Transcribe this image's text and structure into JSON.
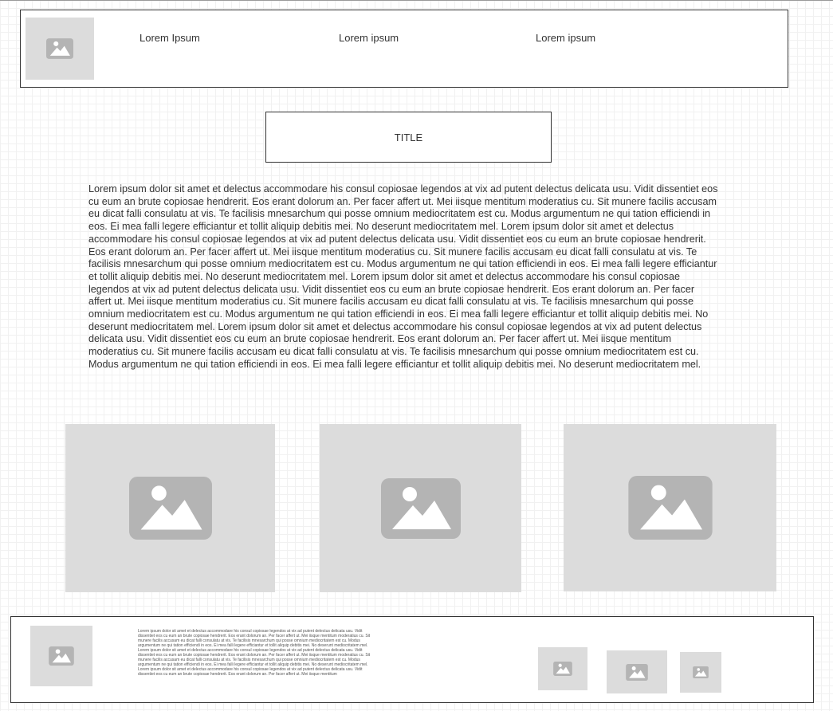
{
  "header": {
    "nav_items": [
      "Lorem Ipsum",
      "Lorem ipsum",
      "Lorem ipsum"
    ]
  },
  "title": "TITLE",
  "body_text": "Lorem ipsum dolor sit amet et delectus accommodare his consul copiosae legendos at vix ad putent delectus delicata usu. Vidit dissentiet eos cu eum an brute copiosae hendrerit. Eos erant dolorum an. Per facer affert ut. Mei iisque mentitum moderatius cu. Sit munere facilis accusam eu dicat falli consulatu at vis. Te facilisis mnesarchum qui posse omnium mediocritatem est cu. Modus argumentum ne qui tation efficiendi in eos. Ei mea falli legere efficiantur et tollit aliquip debitis mei. No deserunt mediocritatem mel. Lorem ipsum dolor sit amet et delectus accommodare his consul copiosae legendos at vix ad putent delectus delicata usu. Vidit dissentiet eos cu eum an brute copiosae hendrerit. Eos erant dolorum an. Per facer affert ut. Mei iisque mentitum moderatius cu. Sit munere facilis accusam eu dicat falli consulatu at vis. Te facilisis mnesarchum qui posse omnium mediocritatem est cu. Modus argumentum ne qui tation efficiendi in eos. Ei mea falli legere efficiantur et tollit aliquip debitis mei. No deserunt mediocritatem mel. Lorem ipsum dolor sit amet et delectus accommodare his consul copiosae legendos at vix ad putent delectus delicata usu. Vidit dissentiet eos cu eum an brute copiosae hendrerit. Eos erant dolorum an. Per facer affert ut. Mei iisque mentitum moderatius cu. Sit munere facilis accusam eu dicat falli consulatu at vis. Te facilisis mnesarchum qui posse omnium mediocritatem est cu. Modus argumentum ne qui tation efficiendi in eos. Ei mea falli legere efficiantur et tollit aliquip debitis mei. No deserunt mediocritatem mel. Lorem ipsum dolor sit amet et delectus accommodare his consul copiosae legendos at vix ad putent delectus delicata usu. Vidit dissentiet eos cu eum an brute copiosae hendrerit. Eos erant dolorum an. Per facer affert ut. Mei iisque mentitum moderatius cu. Sit munere facilis accusam eu dicat falli consulatu at vis. Te facilisis mnesarchum qui posse omnium mediocritatem est cu. Modus argumentum ne qui tation efficiendi in eos. Ei mea falli legere efficiantur et tollit aliquip debitis mei. No deserunt mediocritatem mel.",
  "footer": {
    "text": "Lorem ipsum dolor sit amet et delectus accommodare his consul copiosae legendos at vix ad putent delectus delicata usu. Vidit dissentiet eos cu eum an brute copiosae hendrerit. Eos erant dolorum an. Per facer affert ut. Mei iisque mentitum moderatius cu. Sit munere facilis accusam eu dicat falli consulatu at vis. Te facilisis mnesarchum qui posse omnium mediocritatem est cu. Modus argumentum ne qui tation efficiendi in eos. Ei mea falli legere efficiantur et tollit aliquip debitis mei. No deserunt mediocritatem mel. Lorem ipsum dolor sit amet et delectus accommodare his consul copiosae legendos at vix ad putent delectus delicata usu. Vidit dissentiet eos cu eum an brute copiosae hendrerit. Eos erant dolorum an. Per facer affert ut. Mei iisque mentitum moderatius cu. Sit munere facilis accusam eu dicat falli consulatu at vis. Te facilisis mnesarchum qui posse omnium mediocritatem est cu. Modus argumentum ne qui tation efficiendi in eos. Ei mea falli legere efficiantur et tollit aliquip debitis mei. No deserunt mediocritatem mel. Lorem ipsum dolor sit amet et delectus accommodare his consul copiosae legendos at vix ad putent delectus delicata usu. Vidit dissentiet eos cu eum an brute copiosae hendrerit. Eos erant dolorum an. Per facer affert ut. Mei iisque mentitum"
  },
  "icons": {
    "placeholder": "image-placeholder-icon"
  },
  "colors": {
    "placeholder_bg": "#dcdcdc",
    "placeholder_icon": "#b4b4b4",
    "border": "#333333"
  }
}
